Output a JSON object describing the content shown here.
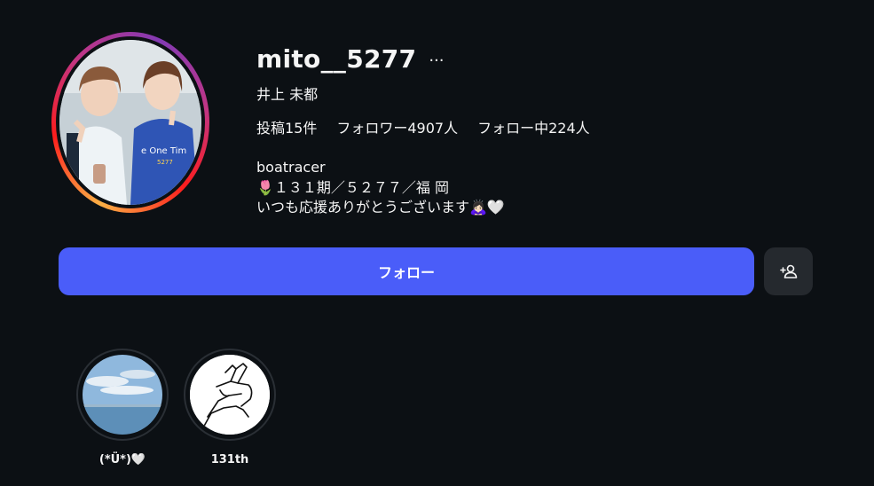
{
  "profile": {
    "username": "mito__5277",
    "full_name": "井上 未都",
    "stats": {
      "posts": "投稿15件",
      "followers": "フォロワー4907人",
      "following": "フォロー中224人"
    },
    "bio": {
      "line1": "boatracer",
      "line2": "🌷１３１期／５２７７／福 岡",
      "line3": "いつも応援ありがとうございます🙇🏻‍♀️🤍"
    }
  },
  "actions": {
    "follow_label": "フォロー",
    "more_label": "···"
  },
  "highlights": [
    {
      "label": "(*Ü*)🤍",
      "icon": "sky-sea-photo"
    },
    {
      "label": "131th",
      "icon": "peace-hands-drawing"
    }
  ],
  "colors": {
    "background": "#0c1014",
    "follow_button": "#4a5df9",
    "secondary_button": "#25292e",
    "text": "#f5f5f5"
  }
}
